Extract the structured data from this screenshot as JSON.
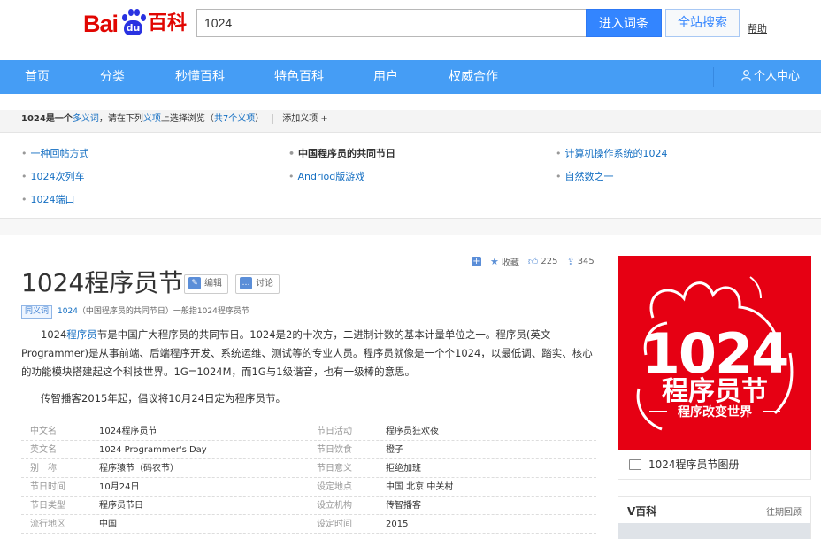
{
  "header": {
    "logo": {
      "bai": "Bai",
      "du": "du",
      "baike": "百科"
    },
    "search_value": "1024",
    "enter_button": "进入词条",
    "site_search_button": "全站搜索",
    "help_link": "帮助"
  },
  "nav": {
    "items": [
      "首页",
      "分类",
      "秒懂百科",
      "特色百科",
      "用户",
      "权威合作"
    ],
    "user_center": "个人中心",
    "color": "#459df5"
  },
  "polysemy": {
    "prefix": "1024是一个",
    "poly_word": "多义词",
    "mid": "，请在下列",
    "sense_word": "义项",
    "suffix": "上选择浏览（",
    "count": "共7个义项",
    "close": "）",
    "add_sense": "添加义项 +",
    "items": [
      "一种回帖方式",
      "中国程序员的共同节日",
      "计算机操作系统的1024",
      "1024次列车",
      "Andriod版游戏",
      "自然数之一",
      "1024端口"
    ]
  },
  "actions": {
    "collect": "收藏",
    "like_count": "225",
    "share_count": "345"
  },
  "entry": {
    "title": "1024程序员节",
    "edit_button": "编辑",
    "discuss_button": "讨论",
    "disambig_tag": "同义词",
    "disambig_link": "1024",
    "disambig_text": "（中国程序员的共同节日）一般指1024程序员节"
  },
  "summary": {
    "p1_a": "1024",
    "p1_kw": "程序员",
    "p1_b": "节是中国广大程序员的共同节日。1024是2的十次方，二进制计数的基本计量单位之一。程序员(英文Programmer)是从事前端、后端程序开发、系统运维、测试等的专业人员。程序员就像是一个个1024，以最低调、踏实、核心的功能模块搭建起这个科技世界。1G=1024M，而1G与1级谐音，也有一级棒的意思。",
    "p2": "传智播客2015年起，倡议将10月24日定为程序员节。"
  },
  "basic_info": [
    {
      "k1": "中文名",
      "v1": "1024程序员节",
      "k2": "节日活动",
      "v2": "程序员狂欢夜"
    },
    {
      "k1": "英文名",
      "v1": "1024 Programmer's Day",
      "k2": "节日饮食",
      "v2": "橙子"
    },
    {
      "k1": "别　称",
      "v1": "程序猿节（码农节）",
      "k2": "节日意义",
      "v2": "拒绝加班"
    },
    {
      "k1": "节日时间",
      "v1": "10月24日",
      "k2": "设定地点",
      "v2": "中国 北京 中关村"
    },
    {
      "k1": "节日类型",
      "v1": "程序员节日",
      "k2": "设立机构",
      "v2": "传智播客"
    },
    {
      "k1": "流行地区",
      "v1": "中国",
      "k2": "设定时间",
      "v2": "2015"
    }
  ],
  "side": {
    "poster_big": "1024",
    "poster_name": "程序员节",
    "poster_slogan": "程序改变世界",
    "poster_color": "#e60013",
    "album_caption": "1024程序员节图册",
    "vbaike_title": "V百科",
    "vbaike_more": "往期回顾"
  }
}
